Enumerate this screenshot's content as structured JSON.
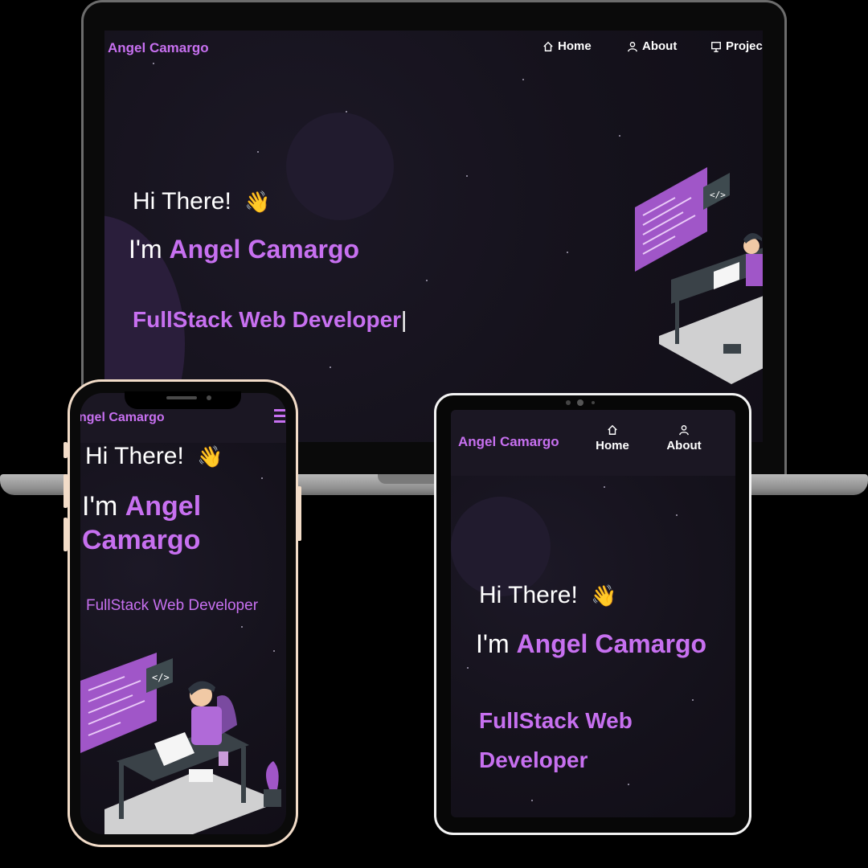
{
  "brand": "Angel Camargo",
  "phone_brand": "ngel Camargo",
  "greeting": "Hi There!",
  "im": "I'm",
  "name": "Angel Camargo",
  "name_line1": "Angel",
  "name_line2": "Camargo",
  "role": "FullStack Web Developer",
  "role_line1": "FullStack Web",
  "role_line2": "Developer",
  "nav": {
    "home": "Home",
    "about": "About",
    "projects": "Projec"
  },
  "code_tag": "</>",
  "colors": {
    "accent": "#c770f0",
    "background": "#15121c",
    "frame_phone": "#f2dcc8"
  },
  "icons": {
    "home": "home-icon",
    "about": "user-icon",
    "projects": "presentation-icon",
    "menu": "hamburger-icon",
    "wave": "waving-hand-icon"
  }
}
